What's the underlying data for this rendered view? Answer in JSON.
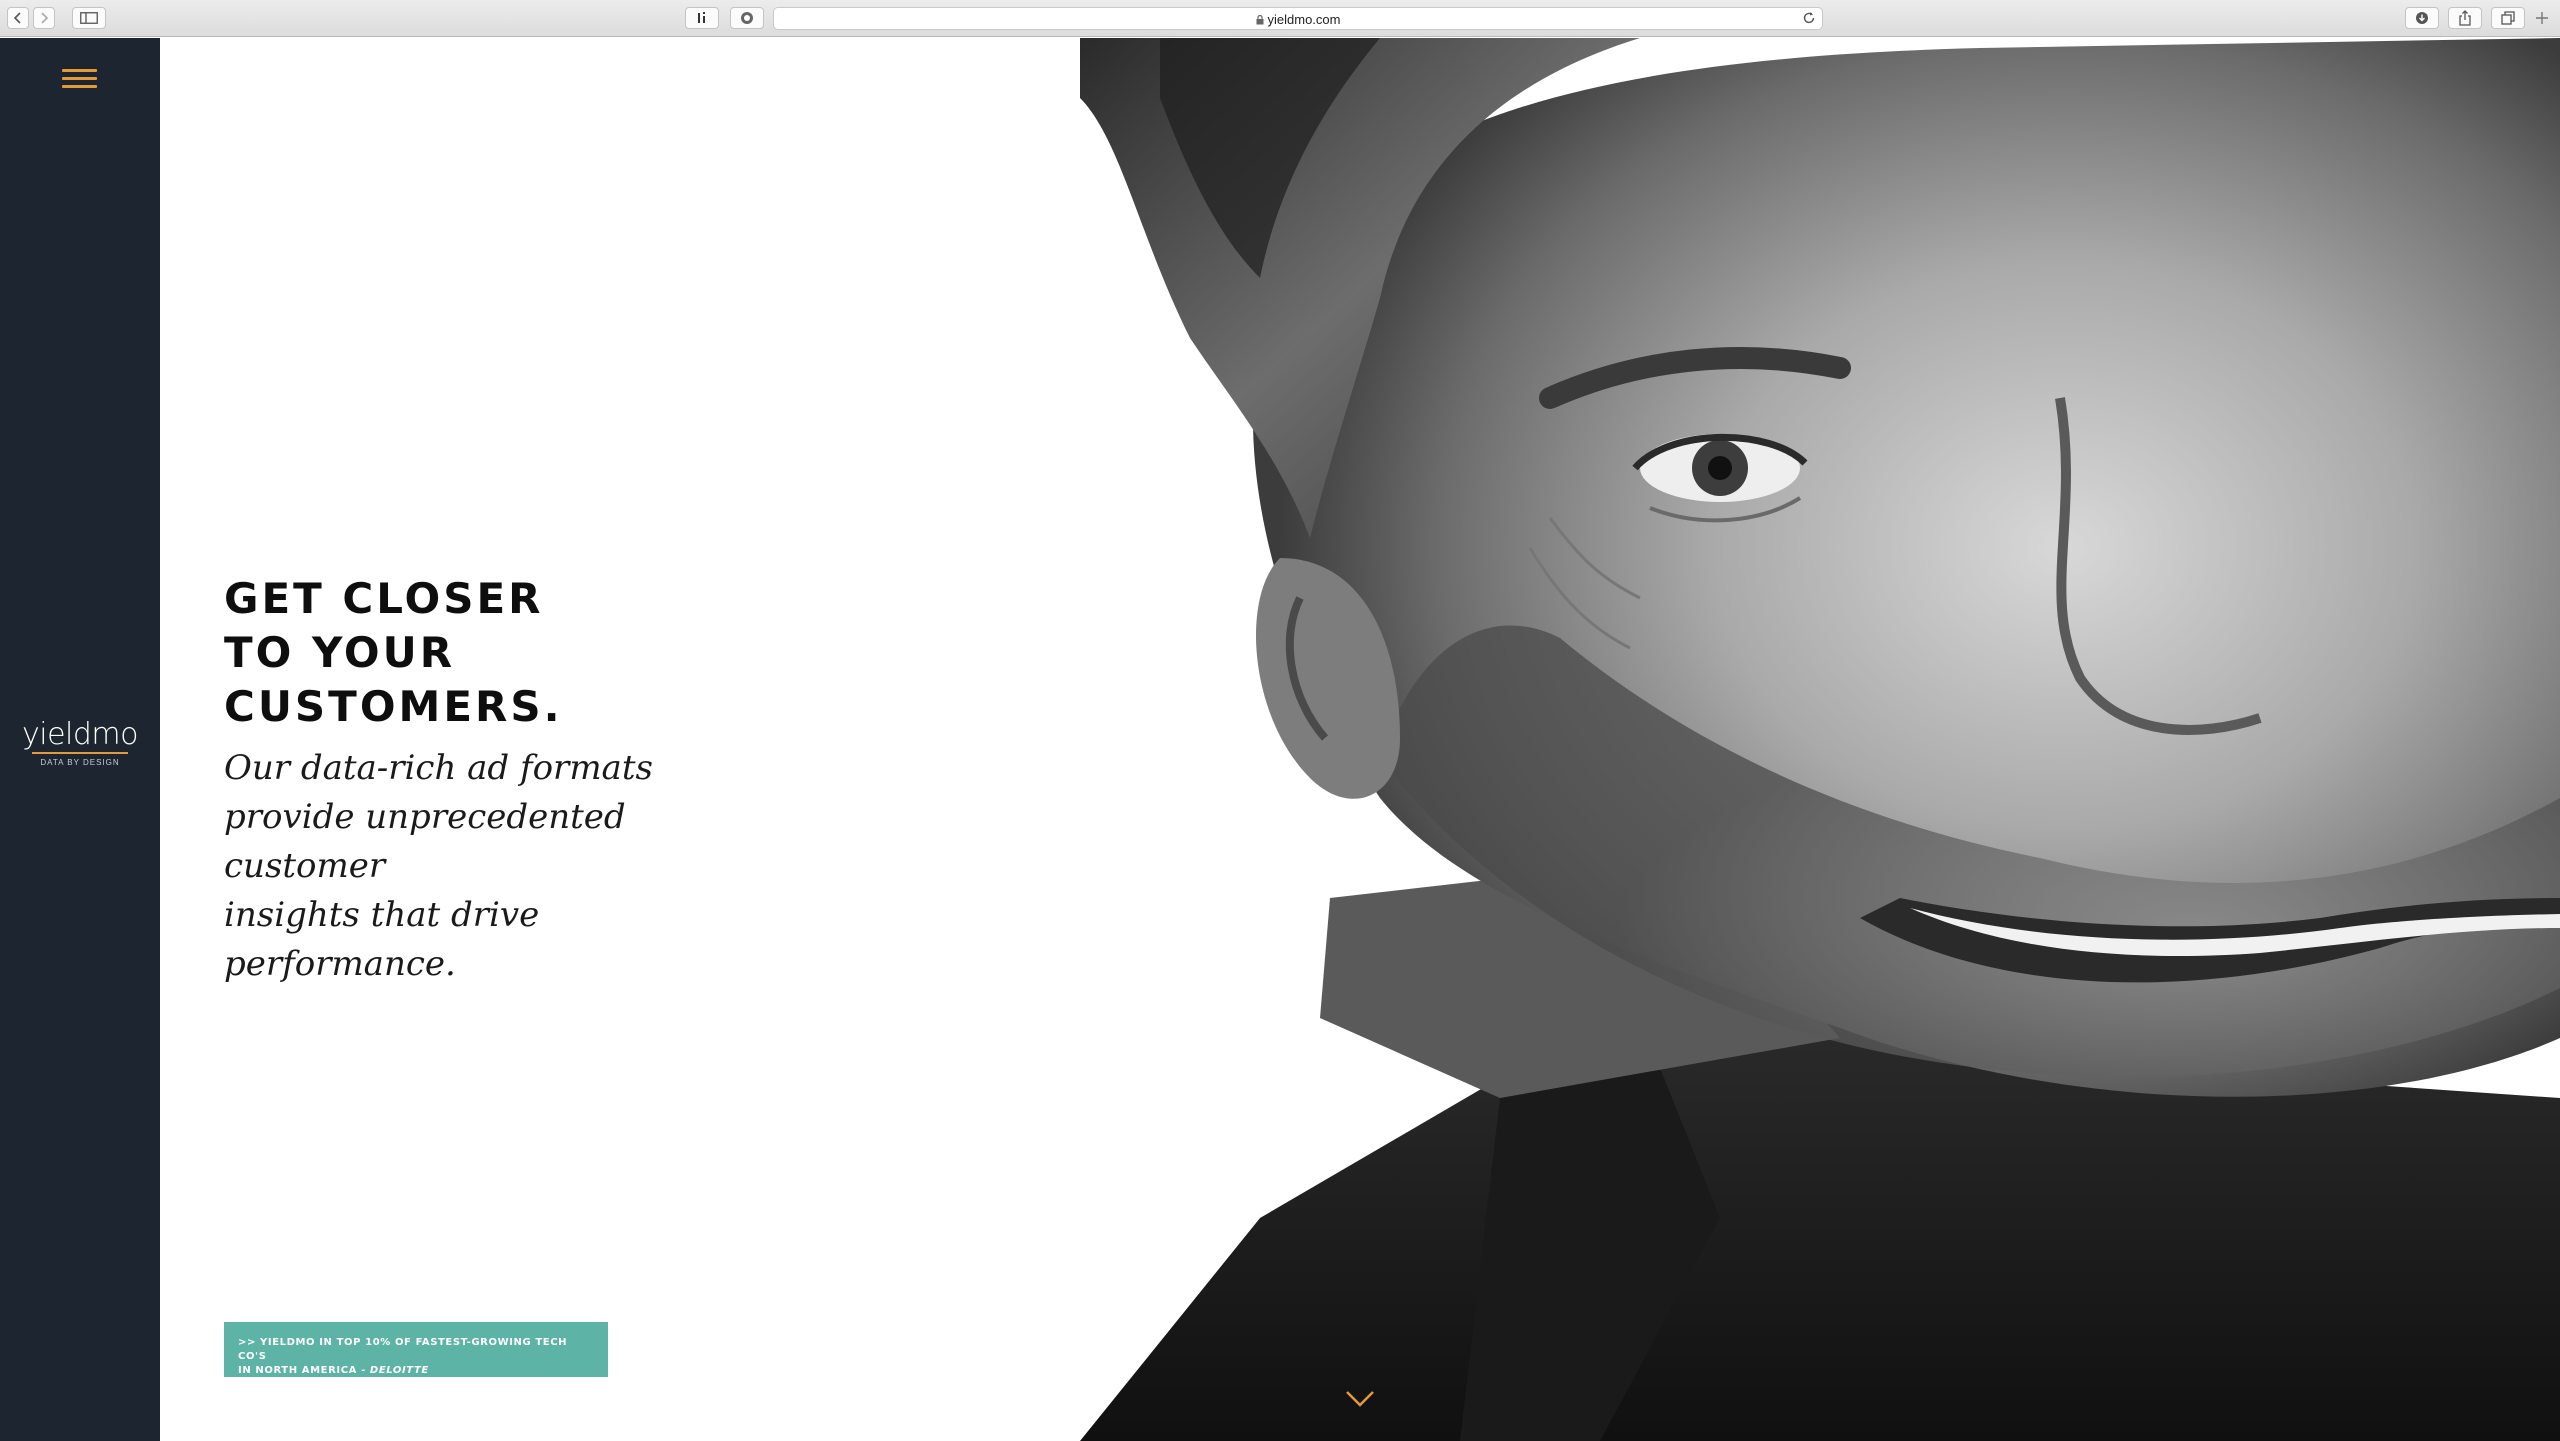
{
  "browser": {
    "url": "yieldmo.com"
  },
  "sidebar": {
    "logo_text": "yieldmo",
    "logo_tagline": "DATA BY DESIGN"
  },
  "hero": {
    "headline_line1": "GET CLOSER",
    "headline_line2": "TO YOUR",
    "headline_line3": "CUSTOMERS.",
    "subhead_line1": "Our data-rich ad formats",
    "subhead_line2": "provide unprecedented customer",
    "subhead_line3": "insights that drive performance.",
    "news_line1": ">> YIELDMO IN TOP 10% OF FASTEST-GROWING TECH CO'S",
    "news_line2": "IN NORTH AMERICA -",
    "news_source": "DELOITTE"
  },
  "colors": {
    "sidebar_bg": "#1c2530",
    "accent": "#e29a3b",
    "badge_bg": "#5cb3a6"
  }
}
